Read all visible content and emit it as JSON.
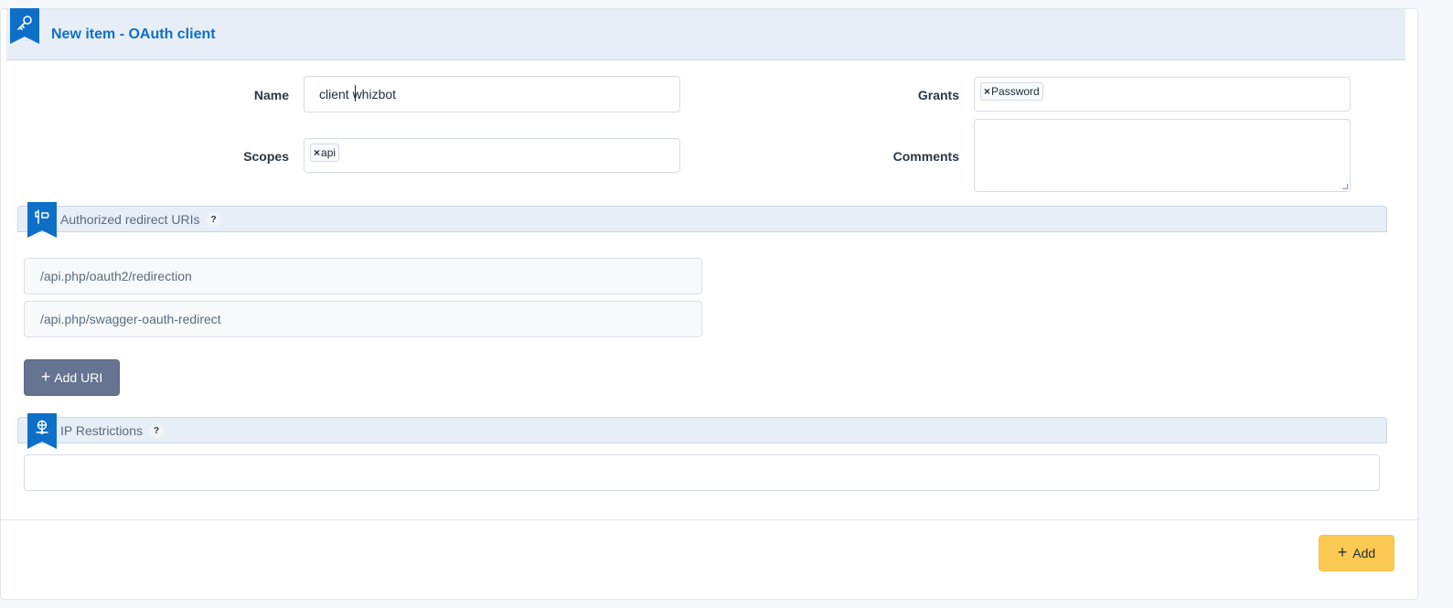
{
  "header": {
    "title": "New item - OAuth client",
    "icon": "key-icon"
  },
  "form": {
    "name_label": "Name",
    "name_value": "client whizbot",
    "scopes_label": "Scopes",
    "scopes_tags": [
      "api"
    ],
    "grants_label": "Grants",
    "grants_tags": [
      "Password"
    ],
    "comments_label": "Comments",
    "comments_value": "",
    "tag_remove_glyph": "×"
  },
  "redirect_section": {
    "title": "Authorized redirect URIs",
    "help": "?",
    "icon": "signpost-icon",
    "uris": [
      "/api.php/oauth2/redirection",
      "/api.php/swagger-oauth-redirect"
    ],
    "add_uri_label": "Add URI",
    "add_glyph": "+"
  },
  "ip_section": {
    "title": "IP Restrictions",
    "help": "?",
    "icon": "network-icon",
    "value": ""
  },
  "footer": {
    "add_label": "Add",
    "add_glyph": "+"
  },
  "colors": {
    "accent": "#0e6fc9",
    "header_bg": "#e8eef7",
    "add_button": "#fcc953",
    "secondary_button": "#667491"
  }
}
